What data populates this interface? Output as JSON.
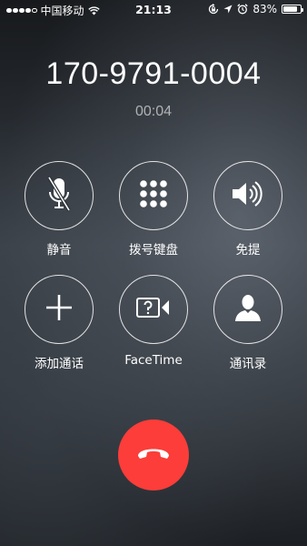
{
  "status_bar": {
    "signal_filled": 4,
    "signal_total": 5,
    "carrier": "中国移动",
    "wifi_icon": "wifi-icon",
    "time": "21:13",
    "rotation_lock_icon": "rotation-lock-icon",
    "location_icon": "location-arrow-icon",
    "alarm_icon": "alarm-clock-icon",
    "battery_percent_text": "83%",
    "battery_level": 0.83
  },
  "call": {
    "number": "170-9791-0004",
    "duration": "00:04"
  },
  "controls": [
    {
      "label": "静音",
      "icon": "mute-microphone-icon"
    },
    {
      "label": "拨号键盘",
      "icon": "keypad-icon"
    },
    {
      "label": "免提",
      "icon": "speaker-icon"
    },
    {
      "label": "添加通话",
      "icon": "plus-icon"
    },
    {
      "label": "FaceTime",
      "icon": "facetime-icon"
    },
    {
      "label": "通讯录",
      "icon": "contacts-icon"
    }
  ],
  "end_call": {
    "icon": "end-call-icon",
    "color": "#fc3d39"
  },
  "colors": {
    "end_call": "#fc3d39",
    "text": "#ffffff",
    "timer": "#b3b3b3"
  }
}
